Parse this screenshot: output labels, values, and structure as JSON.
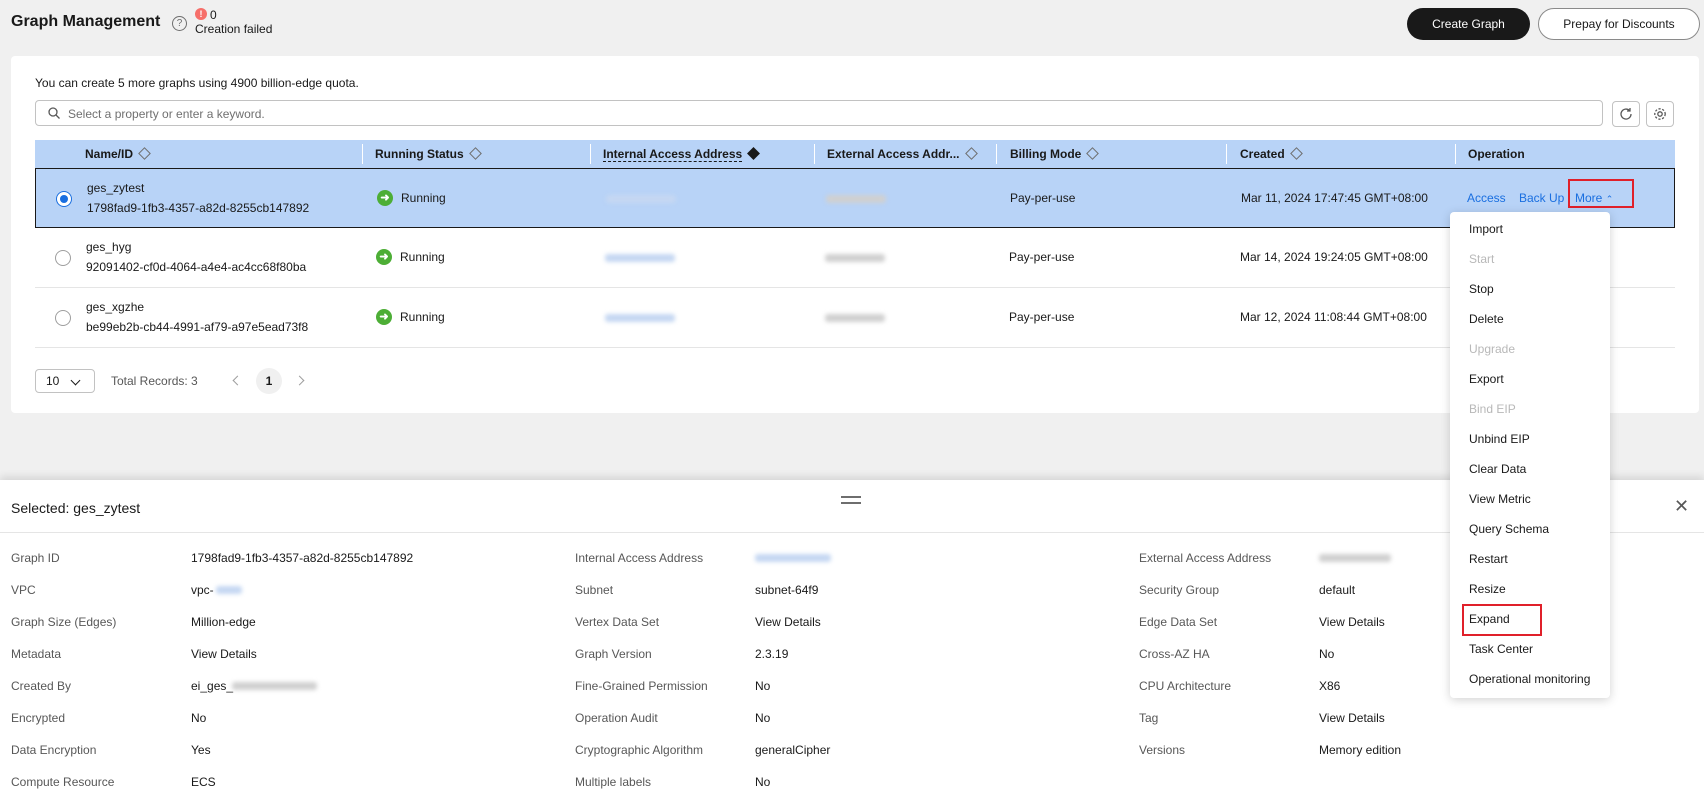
{
  "header": {
    "title": "Graph Management",
    "failed_count": "0",
    "failed_label": "Creation failed",
    "create_button": "Create Graph",
    "prepay_button": "Prepay for Discounts"
  },
  "quota_text": "You can create 5 more graphs using 4900 billion-edge quota.",
  "search": {
    "placeholder": "Select a property or enter a keyword."
  },
  "table": {
    "columns": [
      "Name/ID",
      "Running Status",
      "Internal Access Address",
      "External Access Addr...",
      "Billing Mode",
      "Created",
      "Operation"
    ],
    "rows": [
      {
        "name": "ges_zytest",
        "id": "1798fad9-1fb3-4357-a82d-8255cb147892",
        "status": "Running",
        "billing": "Pay-per-use",
        "created": "Mar 11, 2024 17:47:45 GMT+08:00"
      },
      {
        "name": "ges_hyg",
        "id": "92091402-cf0d-4064-a4e4-ac4cc68f80ba",
        "status": "Running",
        "billing": "Pay-per-use",
        "created": "Mar 14, 2024 19:24:05 GMT+08:00"
      },
      {
        "name": "ges_xgzhe",
        "id": "be99eb2b-cb44-4991-af79-a97e5ead73f8",
        "status": "Running",
        "billing": "Pay-per-use",
        "created": "Mar 12, 2024 11:08:44 GMT+08:00"
      }
    ],
    "operations": {
      "access": "Access",
      "backup": "Back Up",
      "more": "More"
    }
  },
  "pagination": {
    "page_size": "10",
    "total": "Total Records: 3",
    "current_page": "1"
  },
  "menu": {
    "items": [
      "Import",
      "Start",
      "Stop",
      "Delete",
      "Upgrade",
      "Export",
      "Bind EIP",
      "Unbind EIP",
      "Clear Data",
      "View Metric",
      "Query Schema",
      "Restart",
      "Resize",
      "Expand",
      "Task Center",
      "Operational monitoring"
    ]
  },
  "details": {
    "title": "Selected: ges_zytest",
    "col1": [
      {
        "label": "Graph ID",
        "value": "1798fad9-1fb3-4357-a82d-8255cb147892"
      },
      {
        "label": "VPC",
        "value": "vpc-"
      },
      {
        "label": "Graph Size (Edges)",
        "value": "Million-edge"
      },
      {
        "label": "Metadata",
        "value": "View Details"
      },
      {
        "label": "Created By",
        "value": "ei_ges_"
      },
      {
        "label": "Encrypted",
        "value": "No"
      },
      {
        "label": "Data Encryption",
        "value": "Yes"
      },
      {
        "label": "Compute Resource",
        "value": "ECS"
      }
    ],
    "col2": [
      {
        "label": "Internal Access Address",
        "value": ""
      },
      {
        "label": "Subnet",
        "value": "subnet-64f9"
      },
      {
        "label": "Vertex Data Set",
        "value": "View Details"
      },
      {
        "label": "Graph Version",
        "value": "2.3.19"
      },
      {
        "label": "Fine-Grained Permission",
        "value": "No"
      },
      {
        "label": "Operation Audit",
        "value": "No"
      },
      {
        "label": "Cryptographic Algorithm",
        "value": "generalCipher"
      },
      {
        "label": "Multiple labels",
        "value": "No"
      }
    ],
    "col3": [
      {
        "label": "External Access Address",
        "value": ""
      },
      {
        "label": "Security Group",
        "value": "default"
      },
      {
        "label": "Edge Data Set",
        "value": "View Details"
      },
      {
        "label": "Cross-AZ HA",
        "value": "No"
      },
      {
        "label": "CPU Architecture",
        "value": "X86"
      },
      {
        "label": "Tag",
        "value": "View Details"
      },
      {
        "label": "Versions",
        "value": "Memory edition"
      }
    ]
  },
  "colors": {
    "accent": "#1a6fe0",
    "highlight": "#e0202a",
    "running": "#4dae36",
    "selected_row": "#b8d3f7"
  }
}
